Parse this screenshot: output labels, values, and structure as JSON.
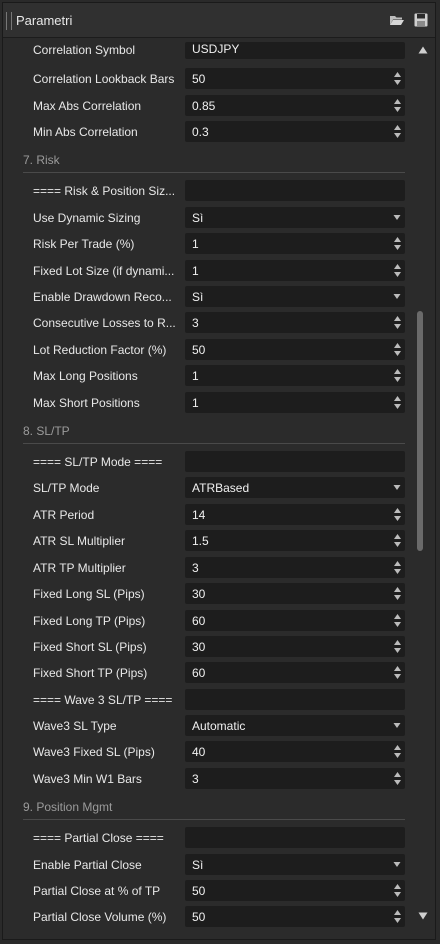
{
  "window": {
    "title": "Parametri",
    "icons": [
      "open-folder-icon",
      "save-icon"
    ]
  },
  "rows": {
    "correlation_symbol": {
      "label": "Correlation Symbol",
      "value": "USDJPY"
    },
    "correlation_lookback": {
      "label": "Correlation Lookback Bars",
      "value": "50"
    },
    "max_abs_correlation": {
      "label": "Max Abs Correlation",
      "value": "0.85"
    },
    "min_abs_correlation": {
      "label": "Min Abs Correlation",
      "value": "0.3"
    },
    "risk_header": {
      "label": "==== Risk & Position Siz...",
      "value": ""
    },
    "use_dynamic_sizing": {
      "label": "Use Dynamic Sizing",
      "value": "Sì"
    },
    "risk_per_trade": {
      "label": "Risk Per Trade (%)",
      "value": "1"
    },
    "fixed_lot_size": {
      "label": "Fixed Lot Size (if dynami...",
      "value": "1"
    },
    "enable_drawdown": {
      "label": "Enable Drawdown Reco...",
      "value": "Sì"
    },
    "consecutive_losses": {
      "label": "Consecutive Losses to R...",
      "value": "3"
    },
    "lot_reduction": {
      "label": "Lot Reduction Factor (%)",
      "value": "50"
    },
    "max_long": {
      "label": "Max Long Positions",
      "value": "1"
    },
    "max_short": {
      "label": "Max Short Positions",
      "value": "1"
    },
    "sltp_header": {
      "label": "==== SL/TP Mode ====",
      "value": ""
    },
    "sltp_mode": {
      "label": "SL/TP Mode",
      "value": "ATRBased"
    },
    "atr_period": {
      "label": "ATR Period",
      "value": "14"
    },
    "atr_sl_mult": {
      "label": "ATR SL Multiplier",
      "value": "1.5"
    },
    "atr_tp_mult": {
      "label": "ATR TP Multiplier",
      "value": "3"
    },
    "fixed_long_sl": {
      "label": "Fixed Long SL (Pips)",
      "value": "30"
    },
    "fixed_long_tp": {
      "label": "Fixed Long TP (Pips)",
      "value": "60"
    },
    "fixed_short_sl": {
      "label": "Fixed Short SL (Pips)",
      "value": "30"
    },
    "fixed_short_tp": {
      "label": "Fixed Short TP (Pips)",
      "value": "60"
    },
    "wave3_header": {
      "label": "==== Wave 3 SL/TP ====",
      "value": ""
    },
    "wave3_sl_type": {
      "label": "Wave3 SL Type",
      "value": "Automatic"
    },
    "wave3_fixed_sl": {
      "label": "Wave3 Fixed SL (Pips)",
      "value": "40"
    },
    "wave3_min_w1": {
      "label": "Wave3 Min W1 Bars",
      "value": "3"
    },
    "partial_header": {
      "label": "==== Partial Close ====",
      "value": ""
    },
    "enable_partial": {
      "label": "Enable Partial Close",
      "value": "Sì"
    },
    "partial_at_tp": {
      "label": "Partial Close at % of TP",
      "value": "50"
    },
    "partial_volume": {
      "label": "Partial Close Volume (%)",
      "value": "50"
    }
  },
  "sections": {
    "risk": "7. Risk",
    "sltp": "8. SL/TP",
    "position": "9. Position Mgmt"
  }
}
